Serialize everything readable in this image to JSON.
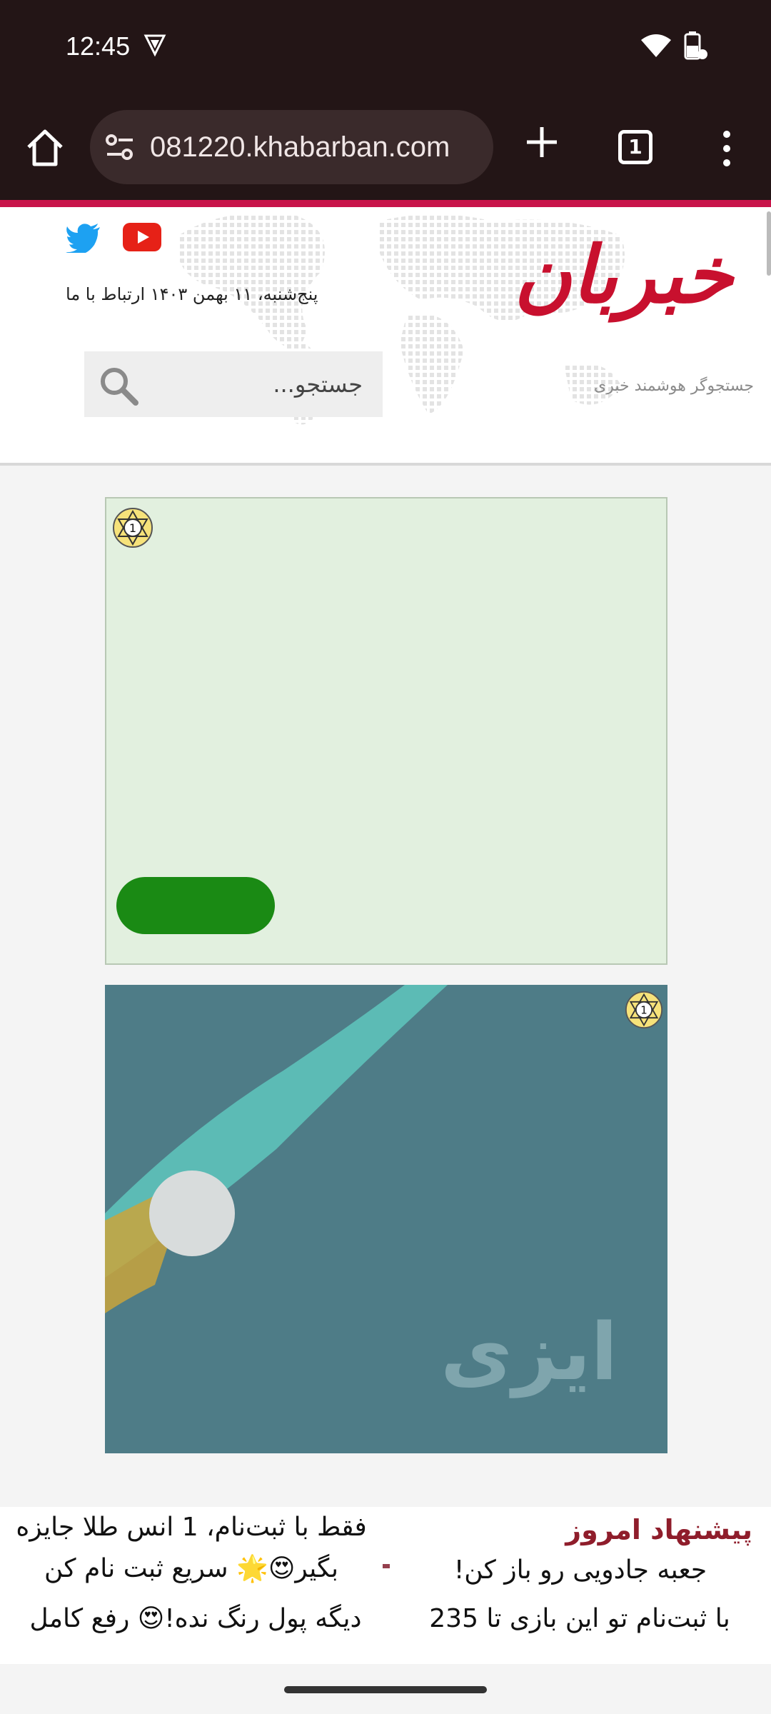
{
  "status_bar": {
    "time": "12:45"
  },
  "browser": {
    "url": "081220.khabarban.com",
    "tab_count": "1"
  },
  "site": {
    "logo_text": "خبربان",
    "tagline": "جستجوگر هوشمند خبری",
    "date_line": "پنج‌شنبه، ۱۱ بهمن ۱۴۰۳  ارتباط با ما",
    "search_placeholder": "جستجو..."
  },
  "ads": {
    "badge_label": "1",
    "ad2_text": "ایزی"
  },
  "promo": {
    "heading": "پیشنهاد امروز",
    "items": [
      "فقط با ثبت‌نام، 1 انس طلا جایزه بگیر😍🌟 سریع ثبت نام کن",
      "جعبه جادویی رو باز کن!",
      "دیگه پول رنگ نده!😍 رفع کامل",
      "با ثبت‌نام تو این بازی تا 235"
    ]
  },
  "colors": {
    "chrome_bg": "#231516",
    "accent_red": "#c8154a",
    "ad1_bg": "#e2f0df",
    "ad1_button": "#1a8a14",
    "ad2_bg": "#4e7c87"
  }
}
